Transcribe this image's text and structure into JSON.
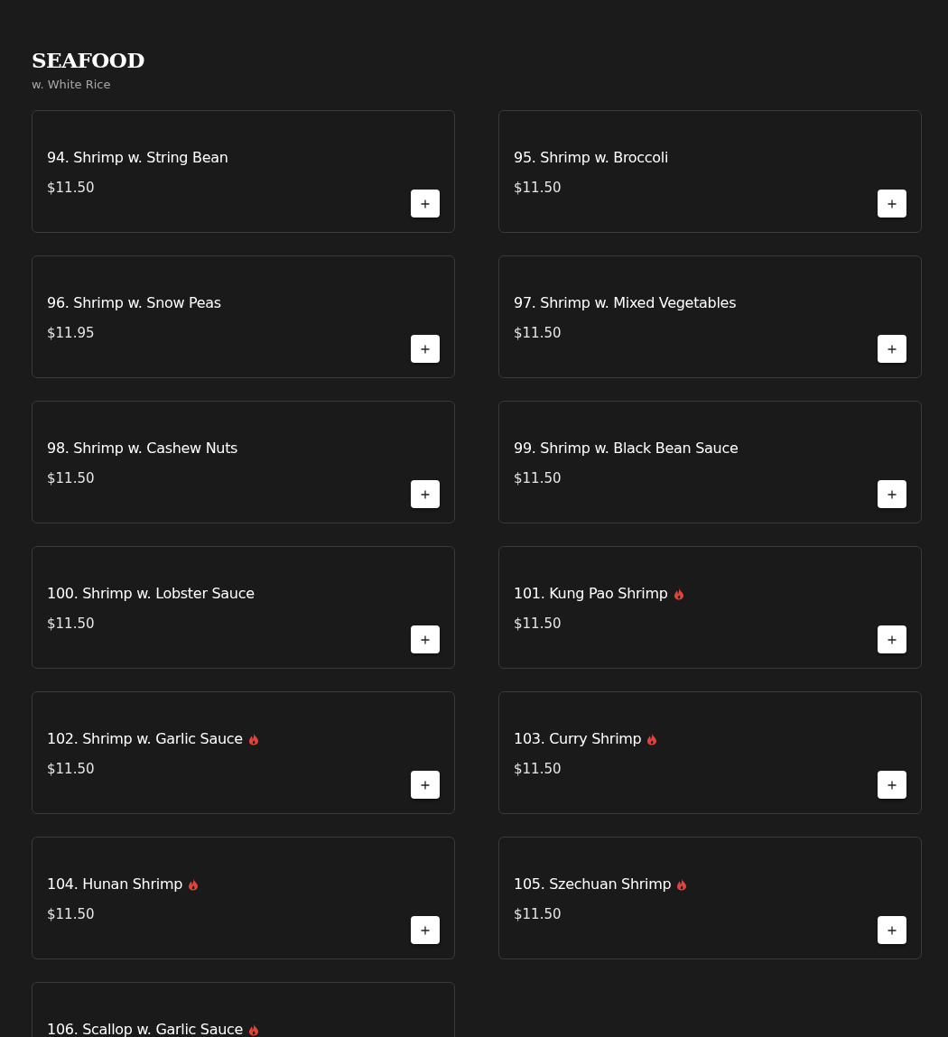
{
  "section": {
    "title": "SEAFOOD",
    "subtitle": "w. White Rice"
  },
  "items": [
    {
      "name": "94. Shrimp w. String Bean",
      "price": "$11.50",
      "spicy": false
    },
    {
      "name": "95. Shrimp w. Broccoli",
      "price": "$11.50",
      "spicy": false
    },
    {
      "name": "96. Shrimp w. Snow Peas",
      "price": "$11.95",
      "spicy": false
    },
    {
      "name": "97. Shrimp w. Mixed Vegetables",
      "price": "$11.50",
      "spicy": false
    },
    {
      "name": "98. Shrimp w. Cashew Nuts",
      "price": "$11.50",
      "spicy": false
    },
    {
      "name": "99. Shrimp w. Black Bean Sauce",
      "price": "$11.50",
      "spicy": false
    },
    {
      "name": "100. Shrimp w. Lobster Sauce",
      "price": "$11.50",
      "spicy": false
    },
    {
      "name": "101. Kung Pao Shrimp",
      "price": "$11.50",
      "spicy": true
    },
    {
      "name": "102. Shrimp w. Garlic Sauce",
      "price": "$11.50",
      "spicy": true
    },
    {
      "name": "103. Curry Shrimp",
      "price": "$11.50",
      "spicy": true
    },
    {
      "name": "104. Hunan Shrimp",
      "price": "$11.50",
      "spicy": true
    },
    {
      "name": "105. Szechuan Shrimp",
      "price": "$11.50",
      "spicy": true
    },
    {
      "name": "106. Scallop w. Garlic Sauce",
      "spicy": true
    }
  ]
}
